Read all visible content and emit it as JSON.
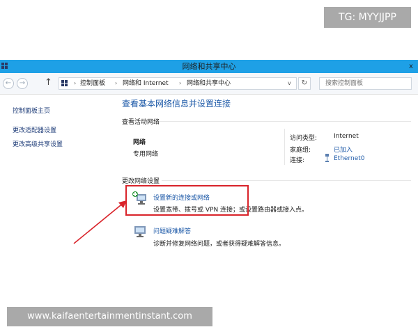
{
  "watermark": {
    "top": "TG: MYYJJPP",
    "bottom": "www.kaifaentertainmentinstant.com"
  },
  "window": {
    "title": "网络和共享中心",
    "close_glyph": "x",
    "accent": "#1ea0e6"
  },
  "navbar": {
    "back_glyph": "←",
    "forward_glyph": "→",
    "up_glyph": "↑",
    "breadcrumbs": [
      "控制面板",
      "网络和 Internet",
      "网络和共享中心"
    ],
    "separator": "›",
    "dropdown_glyph": "v",
    "refresh_glyph": "↻",
    "search_placeholder": "搜索控制面板"
  },
  "sidebar": {
    "items": [
      {
        "label": "控制面板主页"
      },
      {
        "label": "更改适配器设置"
      },
      {
        "label": "更改高级共享设置"
      }
    ]
  },
  "main": {
    "title": "查看基本网络信息并设置连接",
    "active_section": "查看活动网络",
    "network": {
      "name": "网络",
      "type": "专用网络",
      "access_label": "访问类型:",
      "access_value": "Internet",
      "homegroup_label": "家庭组:",
      "homegroup_value": "已加入",
      "connection_label": "连接:",
      "connection_value": "Ethernet0"
    },
    "change_section": "更改网络设置",
    "actions": [
      {
        "label": "设置新的连接或网络",
        "desc": "设置宽带、拨号或 VPN 连接；或设置路由器或接入点。",
        "icon": "network-setup-icon"
      },
      {
        "label": "问题疑难解答",
        "desc": "诊断并修复网络问题，或者获得疑难解答信息。",
        "icon": "troubleshoot-icon"
      }
    ],
    "highlight_color": "#d9232a"
  }
}
